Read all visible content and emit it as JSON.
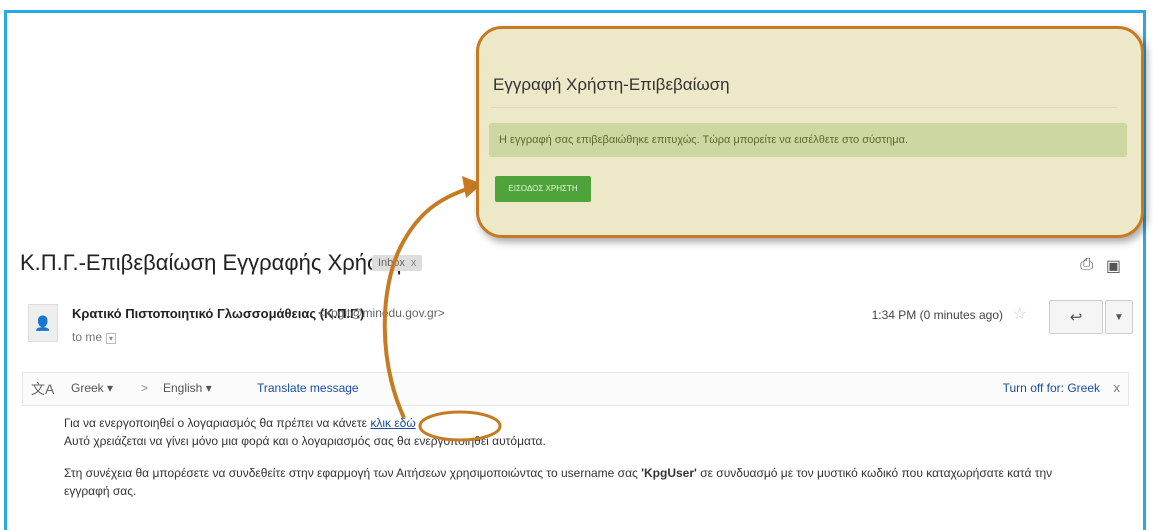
{
  "email": {
    "subject": "Κ.Π.Γ.-Επιβεβαίωση Εγγραφής Χρήστη",
    "label": "Inbox",
    "label_close": "x",
    "sender_name": "Κρατικό Πιστοποιητικό Γλωσσομάθειας (Κ.Π.Γ.)",
    "sender_email": "<kpgit@minedu.gov.gr>",
    "to": "to me",
    "timestamp": "1:34 PM (0 minutes ago)"
  },
  "translate": {
    "from": "Greek ▾",
    "arrow": ">",
    "to": "English ▾",
    "link": "Translate message",
    "turn_off": "Turn off for: Greek",
    "close": "x"
  },
  "body": {
    "line1_text": "Για να ενεργοποιηθεί ο λογαριασμός θα πρέπει να κάνετε ",
    "line1_link": "κλικ εδώ",
    "line2": "Αυτό χρειάζεται να γίνει μόνο μια φορά και ο λογαριασμός σας θα ενεργοποιηθεί αυτόματα.",
    "para2_text": "Στη συνέχεια θα μπορέσετε να συνδεθείτε στην εφαρμογή των Αιτήσεων χρησιμοποιώντας το username σας ",
    "para2_user": "'KpgUser'",
    "para2_rest": " σε συνδυασμό με τον μυστικό κωδικό που καταχωρήσατε κατά την εγγραφή σας."
  },
  "callout": {
    "title": "Εγγραφή Χρήστη-Επιβεβαίωση",
    "message": "Η εγγραφή σας επιβεβαιώθηκε επιτυχώς. Τώρα μπορείτε να εισέλθετε στο σύστημα.",
    "button": "ΕΙΣΟΔΟΣ ΧΡΗΣΤΗ"
  },
  "colors": {
    "frame": "#29a9e0",
    "callout_border": "#c67b22",
    "success": "#cdd7a2",
    "button": "#4ea33a",
    "link": "#1a4ea8"
  }
}
